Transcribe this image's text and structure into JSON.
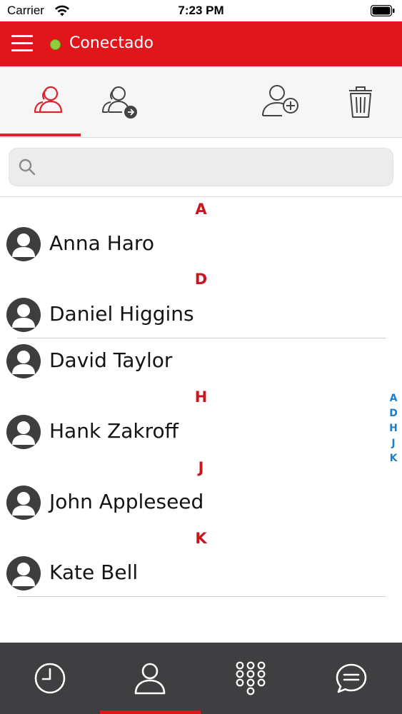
{
  "status_bar": {
    "carrier": "Carrier",
    "time": "7:23 PM"
  },
  "header": {
    "menu_icon": "hamburger-menu-icon",
    "connection_status": "Conectado",
    "connection_color": "#8fce3a",
    "background_color": "#e0161c"
  },
  "toolbar": {
    "tabs": [
      {
        "icon": "contacts-group-icon",
        "active": true
      },
      {
        "icon": "contacts-group-shared-icon",
        "active": false
      }
    ],
    "actions": [
      {
        "icon": "add-contact-icon"
      },
      {
        "icon": "trash-icon"
      }
    ]
  },
  "search": {
    "placeholder": "",
    "value": ""
  },
  "contacts": {
    "sections": [
      {
        "letter": "A",
        "items": [
          "Anna Haro"
        ]
      },
      {
        "letter": "D",
        "items": [
          "Daniel Higgins",
          "David Taylor"
        ]
      },
      {
        "letter": "H",
        "items": [
          "Hank Zakroff"
        ]
      },
      {
        "letter": "J",
        "items": [
          "John Appleseed"
        ]
      },
      {
        "letter": "K",
        "items": [
          "Kate Bell"
        ]
      }
    ],
    "index": [
      "A",
      "D",
      "H",
      "J",
      "K"
    ]
  },
  "bottom_tabs": [
    {
      "icon": "clock-history-icon",
      "active": false
    },
    {
      "icon": "contacts-person-icon",
      "active": true
    },
    {
      "icon": "dialpad-icon",
      "active": false
    },
    {
      "icon": "chat-bubble-icon",
      "active": false
    }
  ],
  "colors": {
    "accent_red": "#e0161c",
    "section_letter": "#c9151b",
    "index_blue": "#1a7fd4",
    "tabbar_bg": "#3f3e40"
  }
}
